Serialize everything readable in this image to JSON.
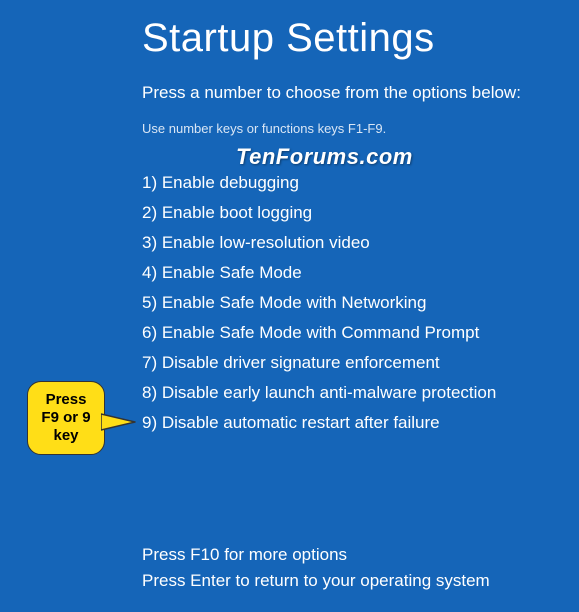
{
  "title": "Startup Settings",
  "subtitle": "Press a number to choose from the options below:",
  "hint": "Use number keys or functions keys F1-F9.",
  "watermark": "TenForums.com",
  "options": [
    "1) Enable debugging",
    "2) Enable boot logging",
    "3) Enable low-resolution video",
    "4) Enable Safe Mode",
    "5) Enable Safe Mode with Networking",
    "6) Enable Safe Mode with Command Prompt",
    "7) Disable driver signature enforcement",
    "8) Disable early launch anti-malware protection",
    "9) Disable automatic restart after failure"
  ],
  "footer": {
    "line1": "Press F10 for more options",
    "line2": "Press Enter to return to your operating system"
  },
  "callout": {
    "line1": "Press",
    "line2": "F9 or 9",
    "line3": "key"
  }
}
